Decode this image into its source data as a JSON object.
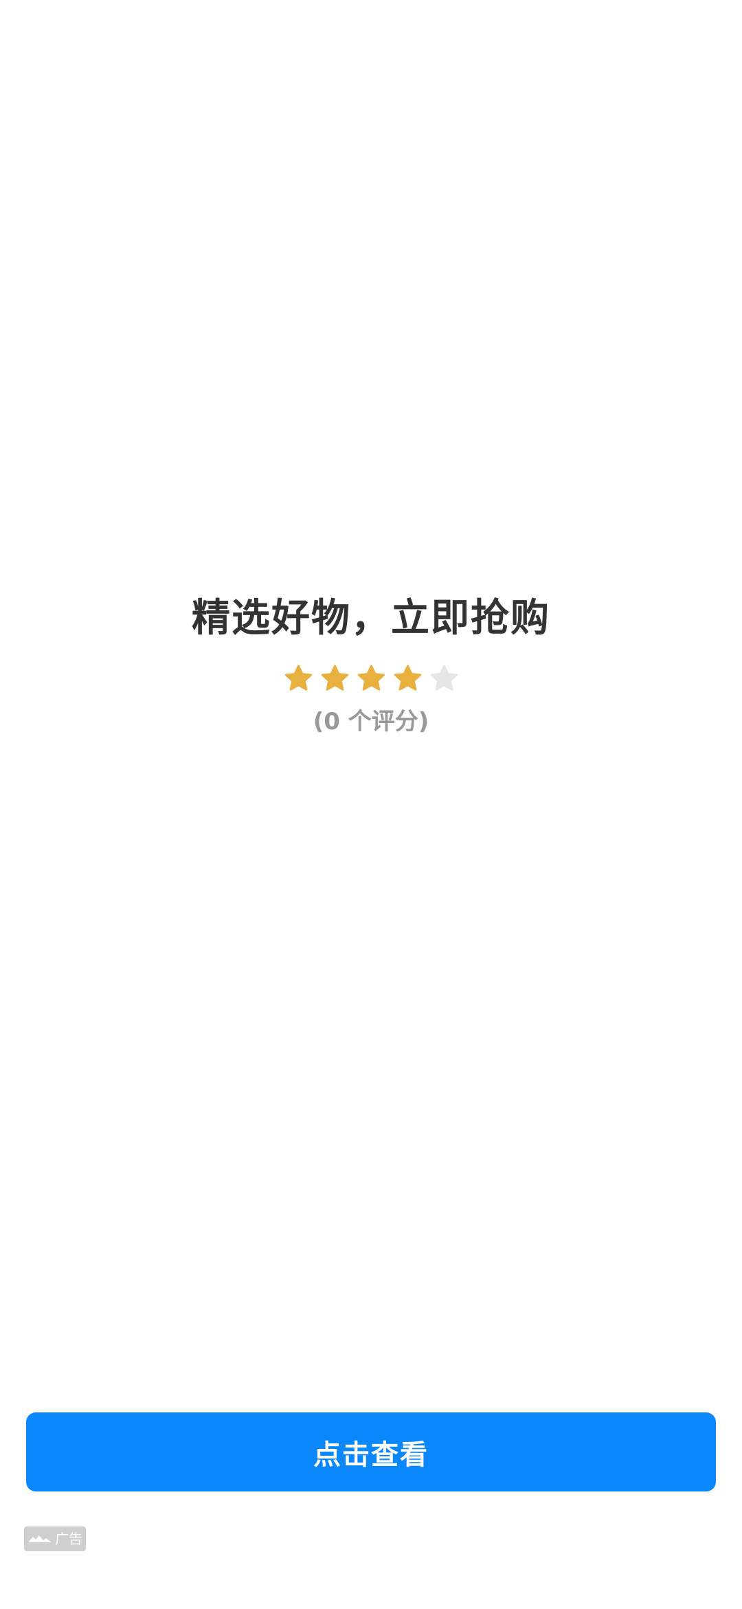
{
  "product": {
    "title": "精选好物，立即抢购",
    "rating": {
      "value": 4,
      "max": 5,
      "count_text": "(0 个评分)",
      "filled_color": "#e8b03f",
      "empty_color": "#e6e6e6"
    }
  },
  "cta": {
    "label": "点击查看",
    "color": "#0a88fb"
  },
  "ad_badge": {
    "icon": "ad-logo-icon",
    "label": "广告"
  }
}
